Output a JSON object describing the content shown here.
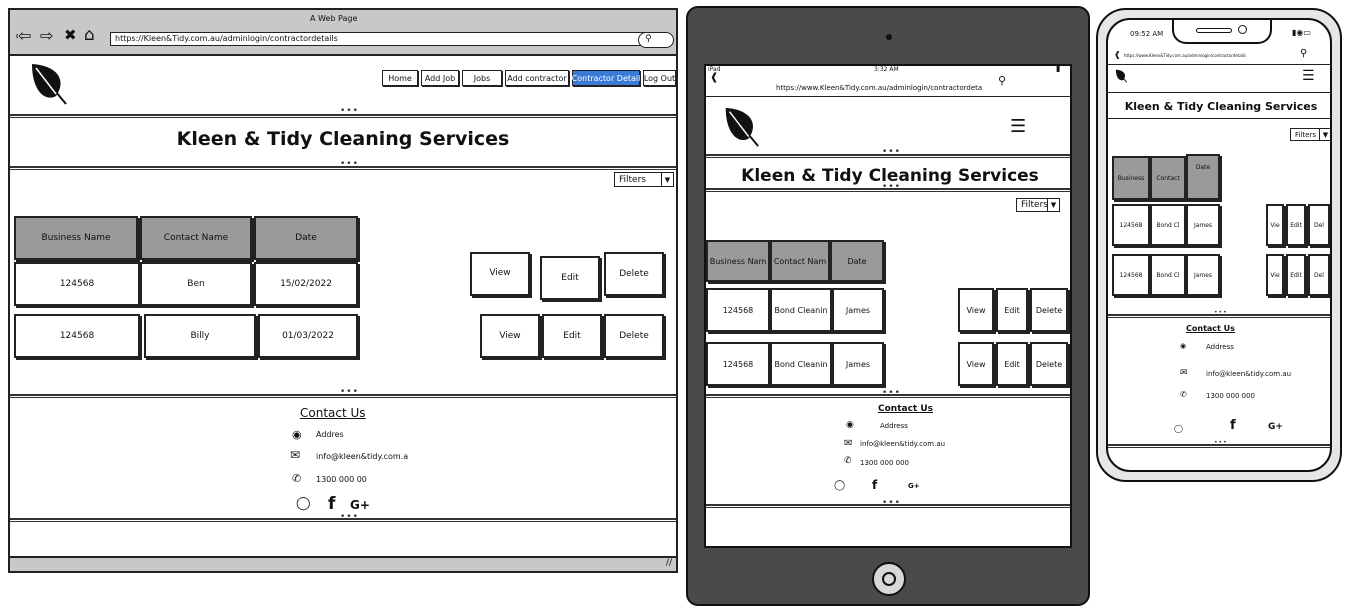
{
  "desktop": {
    "window_title": "A Web Page",
    "url": "https://Kleen&Tidy.com.au/adminlogin/contractordetails",
    "nav": [
      "Home",
      "Add Job",
      "Jobs",
      "Add contractor",
      "Contractor Detail",
      "Log Out"
    ],
    "active_nav": "Contractor Detail",
    "heading": "Kleen & Tidy Cleaning Services",
    "filter": "Filters",
    "table_headers": [
      "Business Name",
      "Contact Name",
      "Date"
    ],
    "rows": [
      {
        "business": "124568",
        "contact": "Ben",
        "date": "15/02/2022"
      },
      {
        "business": "124568",
        "contact": "Billy",
        "date": "01/03/2022"
      }
    ],
    "actions": [
      "View",
      "Edit",
      "Delete"
    ],
    "contact_title": "Contact Us",
    "address": "Addres",
    "email": "info@kleen&tidy.com.a",
    "phone": "1300 000 00",
    "social": [
      "instagram",
      "f",
      "G+"
    ]
  },
  "tablet": {
    "status_left": "iPad",
    "status_time": "3:32 AM",
    "url": "https://www.Kleen&Tidy.com.au/adminlogin/contractordeta",
    "heading": "Kleen & Tidy Cleaning Services",
    "filter": "Filters",
    "table_headers": [
      "Business Nam",
      "Contact Nam",
      "Date"
    ],
    "rows": [
      {
        "business": "124568",
        "contact": "Bond Cleanin",
        "date": "James"
      },
      {
        "business": "124568",
        "contact": "Bond Cleanin",
        "date": "James"
      }
    ],
    "actions": [
      "View",
      "Edit",
      "Delete"
    ],
    "contact_title": "Contact Us",
    "address": "Address",
    "email": "info@kleen&tidy.com.au",
    "phone": "1300 000 000",
    "social": [
      "instagram",
      "f",
      "G+"
    ]
  },
  "phone": {
    "status_time": "09:52 AM",
    "url": "https://www.Kleen&Tidy.com.au/adminlogin/contractordetails",
    "heading": "Kleen & Tidy Cleaning Services",
    "filter": "Filters",
    "table_headers": [
      "Business",
      "Contact",
      "Date"
    ],
    "rows": [
      {
        "business": "124568",
        "contact": "Bond Cl",
        "date": "James"
      },
      {
        "business": "124568",
        "contact": "Bond Cl",
        "date": "James"
      }
    ],
    "actions": [
      "Vie",
      "Edit",
      "Del"
    ],
    "contact_title": "Contact Us",
    "address": "Address",
    "email": "info@kleen&tidy.com.au",
    "phone": "1300 000 000",
    "social": [
      "instagram",
      "f",
      "G+"
    ]
  },
  "colors": {
    "header_fill": "#9a9a9a",
    "active_nav": "#3a7bd5",
    "chrome": "#c8c8c8",
    "tablet_frame": "#4a4a4a"
  }
}
